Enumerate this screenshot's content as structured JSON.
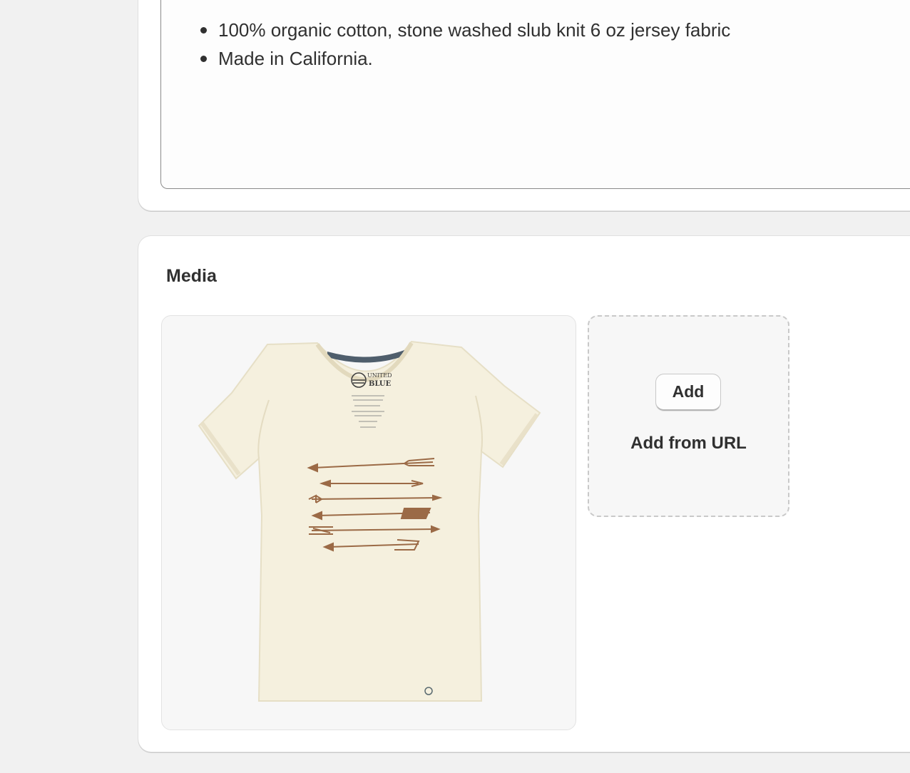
{
  "description": {
    "bullets": [
      "100% organic cotton, stone washed slub knit 6 oz jersey fabric",
      "Made in California."
    ]
  },
  "media": {
    "title": "Media",
    "image": {
      "tag_lines": [
        "UNITED",
        "BLUE"
      ],
      "print": "arrows"
    },
    "dropzone": {
      "add_label": "Add",
      "add_from_url_label": "Add from URL"
    }
  }
}
